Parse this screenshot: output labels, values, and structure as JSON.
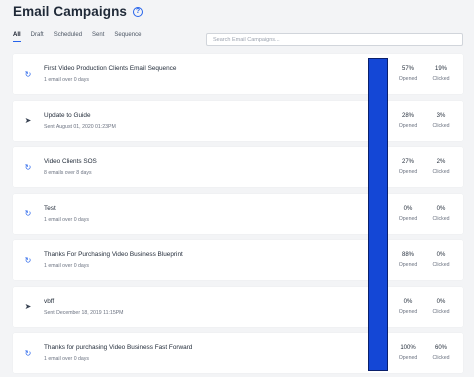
{
  "header": {
    "title": "Email Campaigns",
    "help_icon": "help-circle-icon"
  },
  "tabs": [
    {
      "label": "All",
      "active": true
    },
    {
      "label": "Draft",
      "active": false
    },
    {
      "label": "Scheduled",
      "active": false
    },
    {
      "label": "Sent",
      "active": false
    },
    {
      "label": "Sequence",
      "active": false
    }
  ],
  "search": {
    "placeholder": "Search Email Campaigns..."
  },
  "stat_labels": {
    "opened": "Opened",
    "clicked": "Clicked"
  },
  "campaigns": [
    {
      "icon": "sequence-icon",
      "title": "First Video Production Clients Email Sequence",
      "subtitle": "1 email over 0 days",
      "opened": "57%",
      "clicked": "19%"
    },
    {
      "icon": "send-icon",
      "title": "Update to Guide",
      "subtitle": "Sent August 01, 2020 01:23PM",
      "opened": "28%",
      "clicked": "3%"
    },
    {
      "icon": "sequence-icon",
      "title": "Video Clients SOS",
      "subtitle": "8 emails over 8 days",
      "opened": "27%",
      "clicked": "2%"
    },
    {
      "icon": "sequence-icon",
      "title": "Test",
      "subtitle": "1 email over 0 days",
      "opened": "0%",
      "clicked": "0%"
    },
    {
      "icon": "sequence-icon",
      "title": "Thanks For Purchasing Video Business Blueprint",
      "subtitle": "1 email over 0 days",
      "opened": "88%",
      "clicked": "0%"
    },
    {
      "icon": "send-icon",
      "title": "vbff",
      "subtitle": "Sent December 18, 2019 11:15PM",
      "opened": "0%",
      "clicked": "0%"
    },
    {
      "icon": "sequence-icon",
      "title": "Thanks for purchasing Video Business Fast Forward",
      "subtitle": "1 email over 0 days",
      "opened": "100%",
      "clicked": "60%"
    }
  ],
  "colors": {
    "accent": "#2563eb",
    "overlay_bar": "#1447d6"
  }
}
